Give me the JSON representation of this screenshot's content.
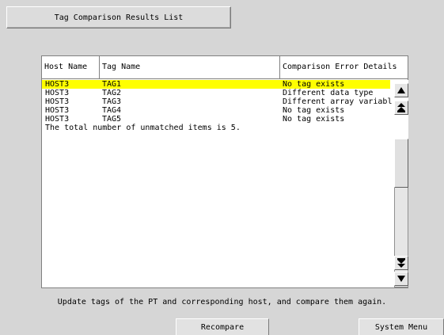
{
  "title_tab": {
    "label": "Tag Comparison Results List"
  },
  "table": {
    "columns": [
      "Host Name",
      "Tag Name",
      "Comparison Error Details"
    ],
    "rows": [
      {
        "host": "HOST3",
        "tag": "TAG1",
        "details": "No tag exists",
        "selected": true
      },
      {
        "host": "HOST3",
        "tag": "TAG2",
        "details": "Different data type",
        "selected": false
      },
      {
        "host": "HOST3",
        "tag": "TAG3",
        "details": "Different array variable",
        "selected": false
      },
      {
        "host": "HOST3",
        "tag": "TAG4",
        "details": "No tag exists",
        "selected": false
      },
      {
        "host": "HOST3",
        "tag": "TAG5",
        "details": "No tag exists",
        "selected": false
      }
    ],
    "summary": "The total number of unmatched items is 5."
  },
  "footer": {
    "message": "Update tags of the PT and corresponding host, and compare them again.",
    "recompare_label": "Recompare",
    "system_menu_label": "System Menu"
  },
  "colors": {
    "background": "#d6d6d6",
    "selected_row": "#ffff00"
  }
}
